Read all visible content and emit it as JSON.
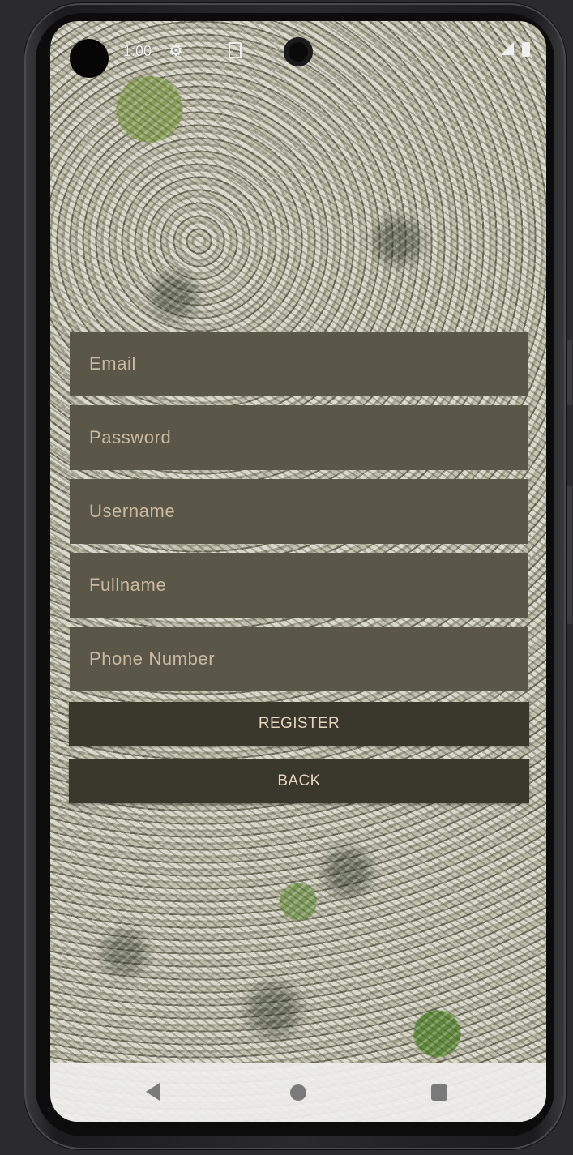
{
  "status_bar": {
    "time": "1:00",
    "settings_icon": "gear-icon",
    "sim_icon": "sim-card-icon",
    "signal_icon": "signal-icon",
    "battery_icon": "battery-icon"
  },
  "form": {
    "email_placeholder": "Email",
    "password_placeholder": "Password",
    "username_placeholder": "Username",
    "fullname_placeholder": "Fullname",
    "phone_placeholder": "Phone Number",
    "register_label": "REGISTER",
    "back_label": "BACK"
  },
  "nav_bar": {
    "back_icon": "nav-back-icon",
    "home_icon": "nav-home-icon",
    "recents_icon": "nav-recents-icon"
  },
  "colors": {
    "field_bg": "#5a5749",
    "field_text": "#cbb9a0",
    "button_bg": "#3a372d",
    "button_text": "#e6d4bf"
  }
}
